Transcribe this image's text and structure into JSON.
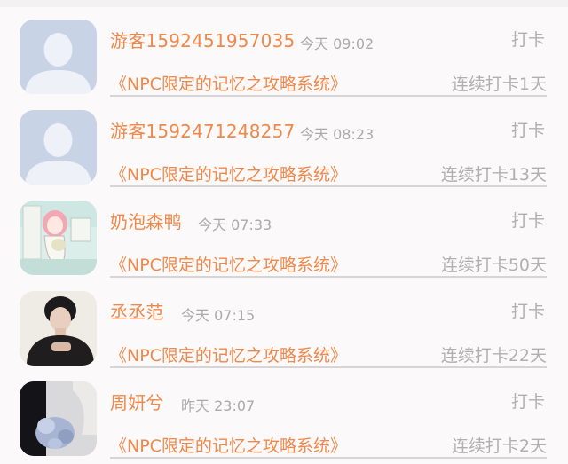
{
  "list": {
    "items": [
      {
        "name": "游客1592451957035",
        "time": "今天 09:02",
        "action": "打卡",
        "book": "《NPC限定的记忆之攻略系统》",
        "streak": "连续打卡1天",
        "avatar_icon": "default-user-avatar-icon"
      },
      {
        "name": "游客1592471248257",
        "time": "今天 08:23",
        "action": "打卡",
        "book": "《NPC限定的记忆之攻略系统》",
        "streak": "连续打卡13天",
        "avatar_icon": "default-user-avatar-icon"
      },
      {
        "name": "奶泡森鸭",
        "time": "今天 07:33",
        "action": "打卡",
        "book": "《NPC限定的记忆之攻略系统》",
        "streak": "连续打卡50天",
        "avatar_icon": "anime-girl-avatar-icon"
      },
      {
        "name": "丞丞范",
        "time": "今天 07:15",
        "action": "打卡",
        "book": "《NPC限定的记忆之攻略系统》",
        "streak": "连续打卡22天",
        "avatar_icon": "photo-avatar-icon"
      },
      {
        "name": "周妍兮",
        "time": "昨天 23:07",
        "action": "打卡",
        "book": "《NPC限定的记忆之攻略系统》",
        "streak": "连续打卡2天",
        "avatar_icon": "flower-photo-avatar-icon"
      }
    ]
  },
  "colors": {
    "accent": "#f0884a",
    "muted": "#b0b0b0",
    "background": "#fbf9fa"
  }
}
